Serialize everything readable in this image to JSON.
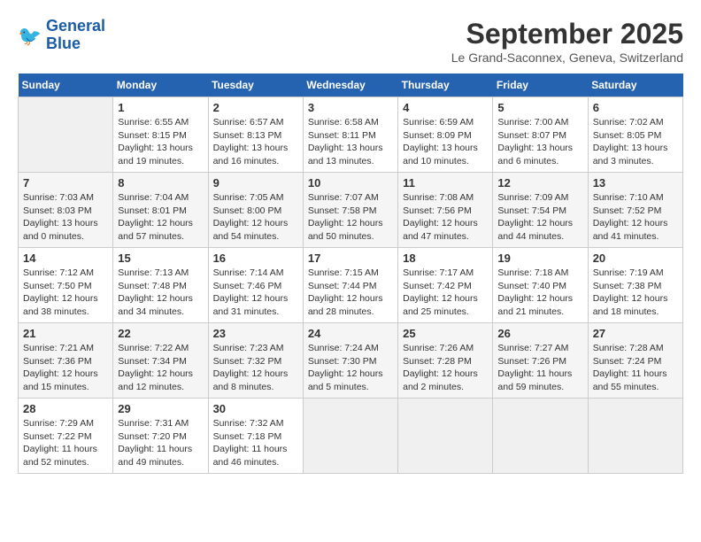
{
  "logo": {
    "text_general": "General",
    "text_blue": "Blue"
  },
  "header": {
    "month": "September 2025",
    "location": "Le Grand-Saconnex, Geneva, Switzerland"
  },
  "weekdays": [
    "Sunday",
    "Monday",
    "Tuesday",
    "Wednesday",
    "Thursday",
    "Friday",
    "Saturday"
  ],
  "weeks": [
    [
      {
        "day": "",
        "empty": true
      },
      {
        "day": "1",
        "sunrise": "Sunrise: 6:55 AM",
        "sunset": "Sunset: 8:15 PM",
        "daylight": "Daylight: 13 hours and 19 minutes."
      },
      {
        "day": "2",
        "sunrise": "Sunrise: 6:57 AM",
        "sunset": "Sunset: 8:13 PM",
        "daylight": "Daylight: 13 hours and 16 minutes."
      },
      {
        "day": "3",
        "sunrise": "Sunrise: 6:58 AM",
        "sunset": "Sunset: 8:11 PM",
        "daylight": "Daylight: 13 hours and 13 minutes."
      },
      {
        "day": "4",
        "sunrise": "Sunrise: 6:59 AM",
        "sunset": "Sunset: 8:09 PM",
        "daylight": "Daylight: 13 hours and 10 minutes."
      },
      {
        "day": "5",
        "sunrise": "Sunrise: 7:00 AM",
        "sunset": "Sunset: 8:07 PM",
        "daylight": "Daylight: 13 hours and 6 minutes."
      },
      {
        "day": "6",
        "sunrise": "Sunrise: 7:02 AM",
        "sunset": "Sunset: 8:05 PM",
        "daylight": "Daylight: 13 hours and 3 minutes."
      }
    ],
    [
      {
        "day": "7",
        "sunrise": "Sunrise: 7:03 AM",
        "sunset": "Sunset: 8:03 PM",
        "daylight": "Daylight: 13 hours and 0 minutes."
      },
      {
        "day": "8",
        "sunrise": "Sunrise: 7:04 AM",
        "sunset": "Sunset: 8:01 PM",
        "daylight": "Daylight: 12 hours and 57 minutes."
      },
      {
        "day": "9",
        "sunrise": "Sunrise: 7:05 AM",
        "sunset": "Sunset: 8:00 PM",
        "daylight": "Daylight: 12 hours and 54 minutes."
      },
      {
        "day": "10",
        "sunrise": "Sunrise: 7:07 AM",
        "sunset": "Sunset: 7:58 PM",
        "daylight": "Daylight: 12 hours and 50 minutes."
      },
      {
        "day": "11",
        "sunrise": "Sunrise: 7:08 AM",
        "sunset": "Sunset: 7:56 PM",
        "daylight": "Daylight: 12 hours and 47 minutes."
      },
      {
        "day": "12",
        "sunrise": "Sunrise: 7:09 AM",
        "sunset": "Sunset: 7:54 PM",
        "daylight": "Daylight: 12 hours and 44 minutes."
      },
      {
        "day": "13",
        "sunrise": "Sunrise: 7:10 AM",
        "sunset": "Sunset: 7:52 PM",
        "daylight": "Daylight: 12 hours and 41 minutes."
      }
    ],
    [
      {
        "day": "14",
        "sunrise": "Sunrise: 7:12 AM",
        "sunset": "Sunset: 7:50 PM",
        "daylight": "Daylight: 12 hours and 38 minutes."
      },
      {
        "day": "15",
        "sunrise": "Sunrise: 7:13 AM",
        "sunset": "Sunset: 7:48 PM",
        "daylight": "Daylight: 12 hours and 34 minutes."
      },
      {
        "day": "16",
        "sunrise": "Sunrise: 7:14 AM",
        "sunset": "Sunset: 7:46 PM",
        "daylight": "Daylight: 12 hours and 31 minutes."
      },
      {
        "day": "17",
        "sunrise": "Sunrise: 7:15 AM",
        "sunset": "Sunset: 7:44 PM",
        "daylight": "Daylight: 12 hours and 28 minutes."
      },
      {
        "day": "18",
        "sunrise": "Sunrise: 7:17 AM",
        "sunset": "Sunset: 7:42 PM",
        "daylight": "Daylight: 12 hours and 25 minutes."
      },
      {
        "day": "19",
        "sunrise": "Sunrise: 7:18 AM",
        "sunset": "Sunset: 7:40 PM",
        "daylight": "Daylight: 12 hours and 21 minutes."
      },
      {
        "day": "20",
        "sunrise": "Sunrise: 7:19 AM",
        "sunset": "Sunset: 7:38 PM",
        "daylight": "Daylight: 12 hours and 18 minutes."
      }
    ],
    [
      {
        "day": "21",
        "sunrise": "Sunrise: 7:21 AM",
        "sunset": "Sunset: 7:36 PM",
        "daylight": "Daylight: 12 hours and 15 minutes."
      },
      {
        "day": "22",
        "sunrise": "Sunrise: 7:22 AM",
        "sunset": "Sunset: 7:34 PM",
        "daylight": "Daylight: 12 hours and 12 minutes."
      },
      {
        "day": "23",
        "sunrise": "Sunrise: 7:23 AM",
        "sunset": "Sunset: 7:32 PM",
        "daylight": "Daylight: 12 hours and 8 minutes."
      },
      {
        "day": "24",
        "sunrise": "Sunrise: 7:24 AM",
        "sunset": "Sunset: 7:30 PM",
        "daylight": "Daylight: 12 hours and 5 minutes."
      },
      {
        "day": "25",
        "sunrise": "Sunrise: 7:26 AM",
        "sunset": "Sunset: 7:28 PM",
        "daylight": "Daylight: 12 hours and 2 minutes."
      },
      {
        "day": "26",
        "sunrise": "Sunrise: 7:27 AM",
        "sunset": "Sunset: 7:26 PM",
        "daylight": "Daylight: 11 hours and 59 minutes."
      },
      {
        "day": "27",
        "sunrise": "Sunrise: 7:28 AM",
        "sunset": "Sunset: 7:24 PM",
        "daylight": "Daylight: 11 hours and 55 minutes."
      }
    ],
    [
      {
        "day": "28",
        "sunrise": "Sunrise: 7:29 AM",
        "sunset": "Sunset: 7:22 PM",
        "daylight": "Daylight: 11 hours and 52 minutes."
      },
      {
        "day": "29",
        "sunrise": "Sunrise: 7:31 AM",
        "sunset": "Sunset: 7:20 PM",
        "daylight": "Daylight: 11 hours and 49 minutes."
      },
      {
        "day": "30",
        "sunrise": "Sunrise: 7:32 AM",
        "sunset": "Sunset: 7:18 PM",
        "daylight": "Daylight: 11 hours and 46 minutes."
      },
      {
        "day": "",
        "empty": true
      },
      {
        "day": "",
        "empty": true
      },
      {
        "day": "",
        "empty": true
      },
      {
        "day": "",
        "empty": true
      }
    ]
  ]
}
